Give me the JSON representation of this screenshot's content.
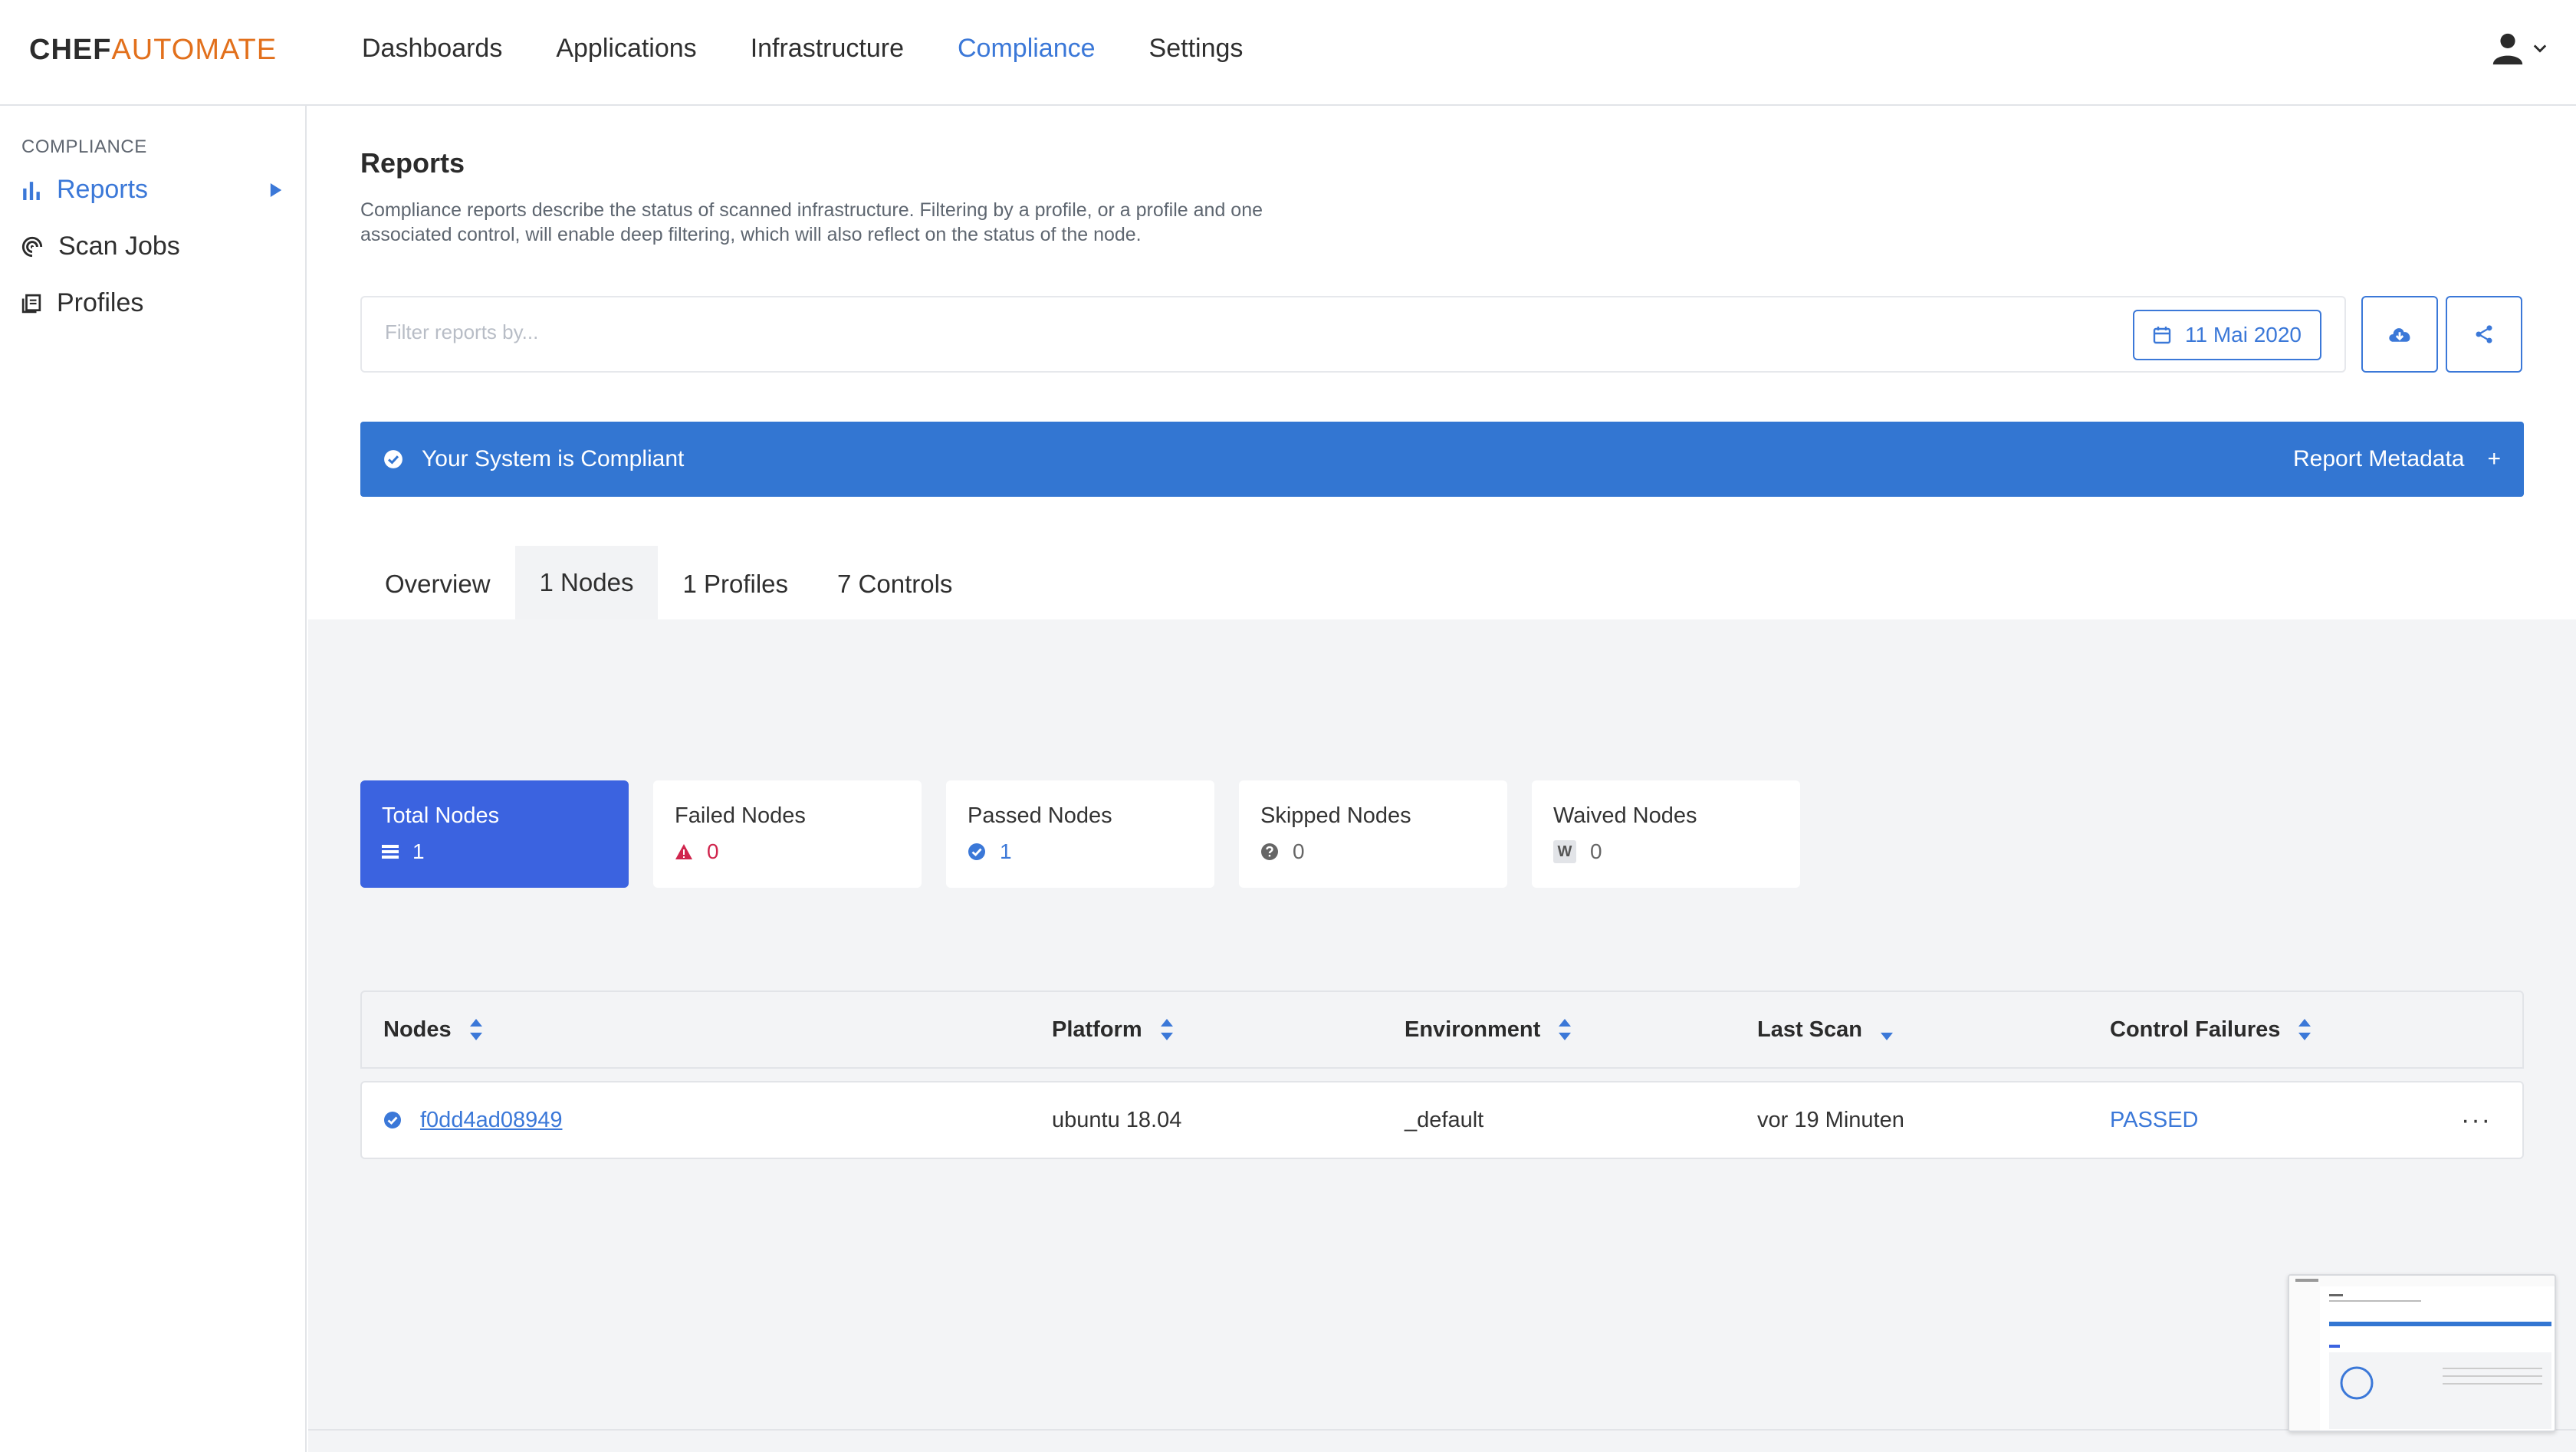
{
  "brand": {
    "part1": "CHEF",
    "part2": "AUTOMATE"
  },
  "nav": {
    "items": [
      {
        "label": "Dashboards"
      },
      {
        "label": "Applications"
      },
      {
        "label": "Infrastructure"
      },
      {
        "label": "Compliance",
        "active": true
      },
      {
        "label": "Settings"
      }
    ]
  },
  "sidebar": {
    "section": "COMPLIANCE",
    "items": [
      {
        "label": "Reports",
        "icon": "bar-chart-icon",
        "active": true
      },
      {
        "label": "Scan Jobs",
        "icon": "scan-jobs-icon"
      },
      {
        "label": "Profiles",
        "icon": "profiles-icon"
      }
    ]
  },
  "page": {
    "title": "Reports",
    "description": "Compliance reports describe the status of scanned infrastructure. Filtering by a profile, or a profile and one associated control, will enable deep filtering, which will also reflect on the status of the node."
  },
  "filter": {
    "placeholder": "Filter reports by...",
    "date": "11 Mai 2020"
  },
  "actions": {
    "download_icon": "cloud-download-icon",
    "share_icon": "share-icon"
  },
  "banner": {
    "status": "Your System is Compliant",
    "metadata": "Report Metadata",
    "plus": "+"
  },
  "tabs": [
    {
      "label": "Overview"
    },
    {
      "label": "1 Nodes",
      "active": true
    },
    {
      "label": "1 Profiles"
    },
    {
      "label": "7 Controls"
    }
  ],
  "stats": [
    {
      "label": "Total Nodes",
      "value": "1",
      "icon": "list-icon",
      "active": true
    },
    {
      "label": "Failed Nodes",
      "value": "0",
      "icon": "warning-icon"
    },
    {
      "label": "Passed Nodes",
      "value": "1",
      "icon": "check-circle-icon"
    },
    {
      "label": "Skipped Nodes",
      "value": "0",
      "icon": "question-circle-icon"
    },
    {
      "label": "Waived Nodes",
      "value": "0",
      "icon": "waived-icon",
      "badge": "W"
    }
  ],
  "table": {
    "columns": [
      "Nodes",
      "Platform",
      "Environment",
      "Last Scan",
      "Control Failures"
    ],
    "rows": [
      {
        "node": "f0dd4ad08949",
        "platform": "ubuntu 18.04",
        "environment": "_default",
        "last_scan": "vor 19 Minuten",
        "control_failures": "PASSED",
        "more": "···"
      }
    ]
  },
  "colors": {
    "accent": "#3b78d8",
    "banner": "#3376d2",
    "active_stat": "#3b63e0",
    "brand_orange": "#e2701c",
    "failed": "#d0254d"
  }
}
